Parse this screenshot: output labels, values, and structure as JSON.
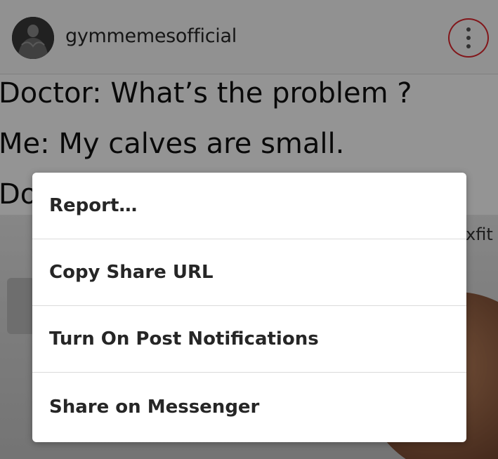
{
  "post_header": {
    "username": "gymmemesofficial",
    "avatar_icon": "profile-avatar-icon",
    "more_icon": "more-vertical-icon",
    "highlight_color": "#e0262d"
  },
  "meme": {
    "lines": [
      "Doctor: What’s the problem ?",
      "Me: My calves are small.",
      "Do"
    ],
    "watermark": "xfit"
  },
  "menu": {
    "items": [
      {
        "label": "Report…"
      },
      {
        "label": "Copy Share URL"
      },
      {
        "label": "Turn On Post Notifications"
      },
      {
        "label": "Share on Messenger"
      }
    ]
  }
}
